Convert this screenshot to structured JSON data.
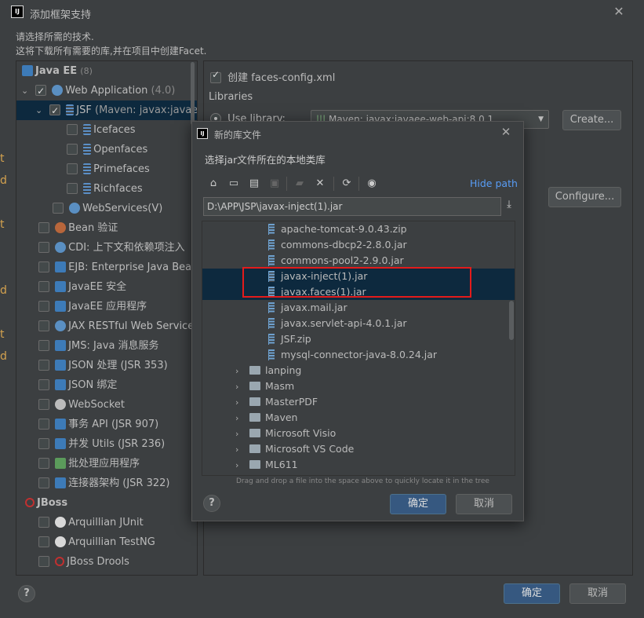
{
  "window": {
    "title": "添加框架支持",
    "desc_line1": "请选择所需的技术.",
    "desc_line2": "这将下载所有需要的库,并在项目中创建Facet.",
    "app_icon": "IJ"
  },
  "tree": {
    "group_javaee": "Java EE",
    "group_javaee_count": "(8)",
    "web_app": "Web Application",
    "web_app_version": "(4.0)",
    "jsf": "JSF",
    "jsf_detail": "(Maven: javax:javaee-w",
    "icefaces": "Icefaces",
    "openfaces": "Openfaces",
    "primefaces": "Primefaces",
    "richfaces": "Richfaces",
    "webservices": "WebServices(V)",
    "bean": "Bean 验证",
    "cdi": "CDI: 上下文和依赖项注入",
    "ejb": "EJB: Enterprise Java Beans",
    "javaee_security": "JavaEE 安全",
    "javaee_app": "JavaEE 应用程序",
    "jax_rest": "JAX RESTful Web Services",
    "jms": "JMS: Java 消息服务",
    "json_proc": "JSON 处理 (JSR 353)",
    "json_bind": "JSON 绑定",
    "websocket": "WebSocket",
    "tx_api": "事务 API (JSR 907)",
    "concurrency": "并发 Utils (JSR 236)",
    "batch": "批处理应用程序",
    "connector": "连接器架构 (JSR 322)",
    "group_jboss": "JBoss",
    "arq_junit": "Arquillian JUnit",
    "arq_testng": "Arquillian TestNG",
    "jboss_drools": "JBoss Drools"
  },
  "right": {
    "create_faces_config": "创建 faces-config.xml",
    "libraries": "Libraries",
    "use_library": "Use library:",
    "library_value": "Maven: javax:javaee-web-api:8.0.1",
    "create_btn": "Create...",
    "configure_btn": "Configure..."
  },
  "dialog": {
    "title": "新的库文件",
    "app_icon": "IJ",
    "subtitle": "选择jar文件所在的本地类库",
    "hide_path": "Hide path",
    "path": "D:\\APP\\JSP\\javax-inject(1).jar",
    "hint": "Drag and drop a file into the space above to quickly locate it in the tree",
    "ok": "确定",
    "cancel": "取消",
    "files": [
      "apache-tomcat-9.0.43.zip",
      "commons-dbcp2-2.8.0.jar",
      "commons-pool2-2.9.0.jar",
      "javax-inject(1).jar",
      "javax.faces(1).jar",
      "javax.mail.jar",
      "javax.servlet-api-4.0.1.jar",
      "JSF.zip",
      "mysql-connector-java-8.0.24.jar"
    ],
    "folders": [
      "lanping",
      "Masm",
      "MasterPDF",
      "Maven",
      "Microsoft Visio",
      "Microsoft VS Code",
      "ML611"
    ]
  },
  "footer": {
    "ok": "确定",
    "cancel": "取消",
    "help": "?"
  },
  "colors": {
    "background": "#3c3f41",
    "selection": "#0d293e",
    "primary_button": "#365880",
    "highlight_box": "#e31b1b",
    "link": "#589df6"
  }
}
